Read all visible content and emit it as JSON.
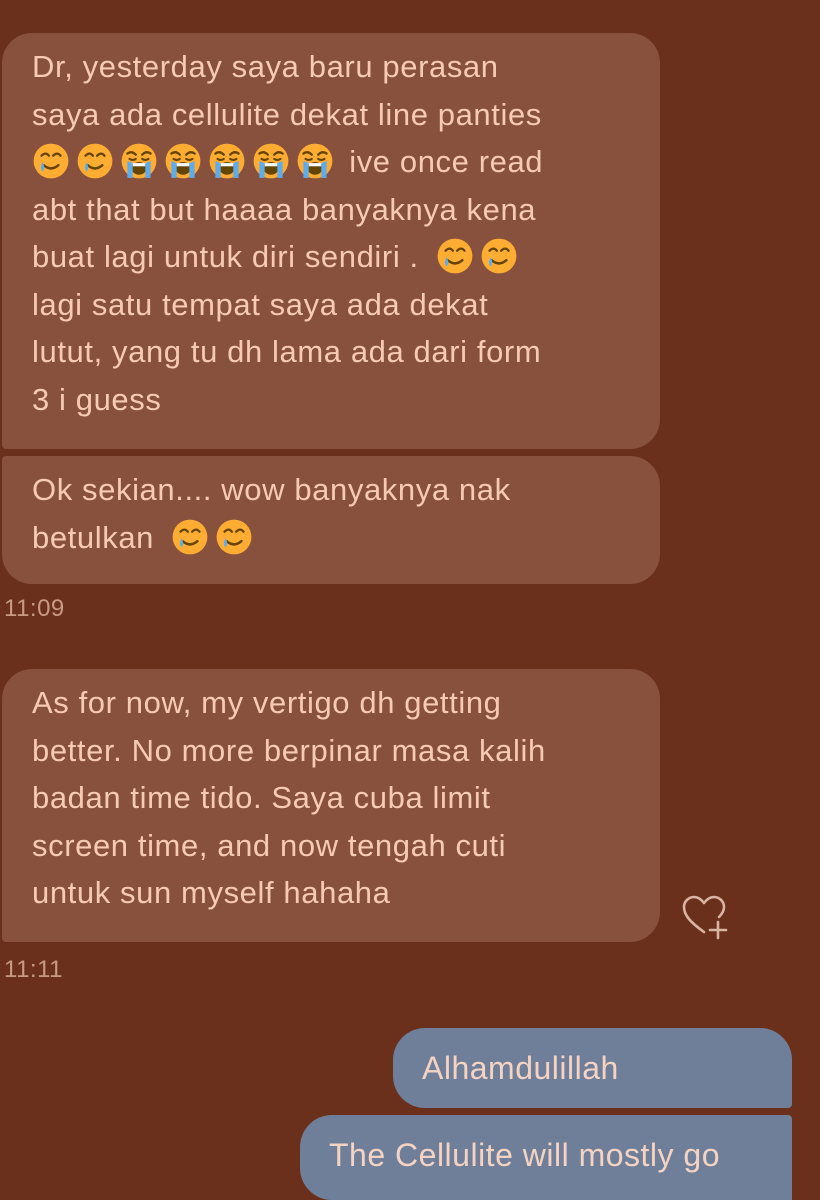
{
  "messages": [
    {
      "lines": [
        "Dr, yesterday saya baru perasan",
        "saya ada cellulite dekat line panties",
        "abt that but haaaa banyaknya kena",
        "buat lagi untuk diri sendiri .",
        "lagi satu tempat saya ada dekat",
        "lutut, yang tu dh lama ada dari form",
        "3 i guess"
      ],
      "line3_tail": "ive once read"
    },
    {
      "lines": [
        "Ok sekian.... wow banyaknya nak",
        "betulkan"
      ]
    },
    {
      "lines": [
        "As for now, my vertigo dh getting",
        "better. No more berpinar masa kalih",
        "badan time tido. Saya cuba limit",
        "screen time, and now tengah cuti",
        "untuk sun myself hahaha"
      ]
    },
    {
      "text": "Alhamdulillah"
    },
    {
      "text": "The Cellulite will mostly go"
    }
  ],
  "timestamps": [
    "11:09",
    "11:11"
  ],
  "emoji": {
    "tear_smile": "smiling-face-with-tear",
    "sob": "loudly-crying-face"
  },
  "colors": {
    "background": "#6b301c",
    "incoming_bubble": "#87513d",
    "outgoing_bubble": "#6f7f99",
    "text": "#f7cbb2",
    "timestamp": "#c79a84"
  },
  "icons": {
    "react": "heart-plus-icon"
  }
}
